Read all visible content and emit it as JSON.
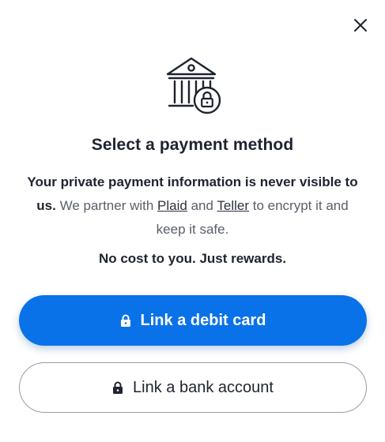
{
  "dialog": {
    "close_icon": "close-icon",
    "illustration_icon": "bank-lock-icon",
    "title": "Select a payment method",
    "description": {
      "bold_part": "Your private payment information is never visible to us.",
      "text_before_plaid": " We partner with ",
      "link_plaid": "Plaid",
      "text_between": " and ",
      "link_teller": "Teller",
      "text_after": " to encrypt it and keep it safe."
    },
    "tagline": "No cost to you. Just rewards.",
    "buttons": {
      "debit_card": "Link a debit card",
      "bank_account": "Link a bank account"
    }
  },
  "colors": {
    "primary": "#0a72e8",
    "text": "#1f2330",
    "muted": "#5a5e6a"
  }
}
